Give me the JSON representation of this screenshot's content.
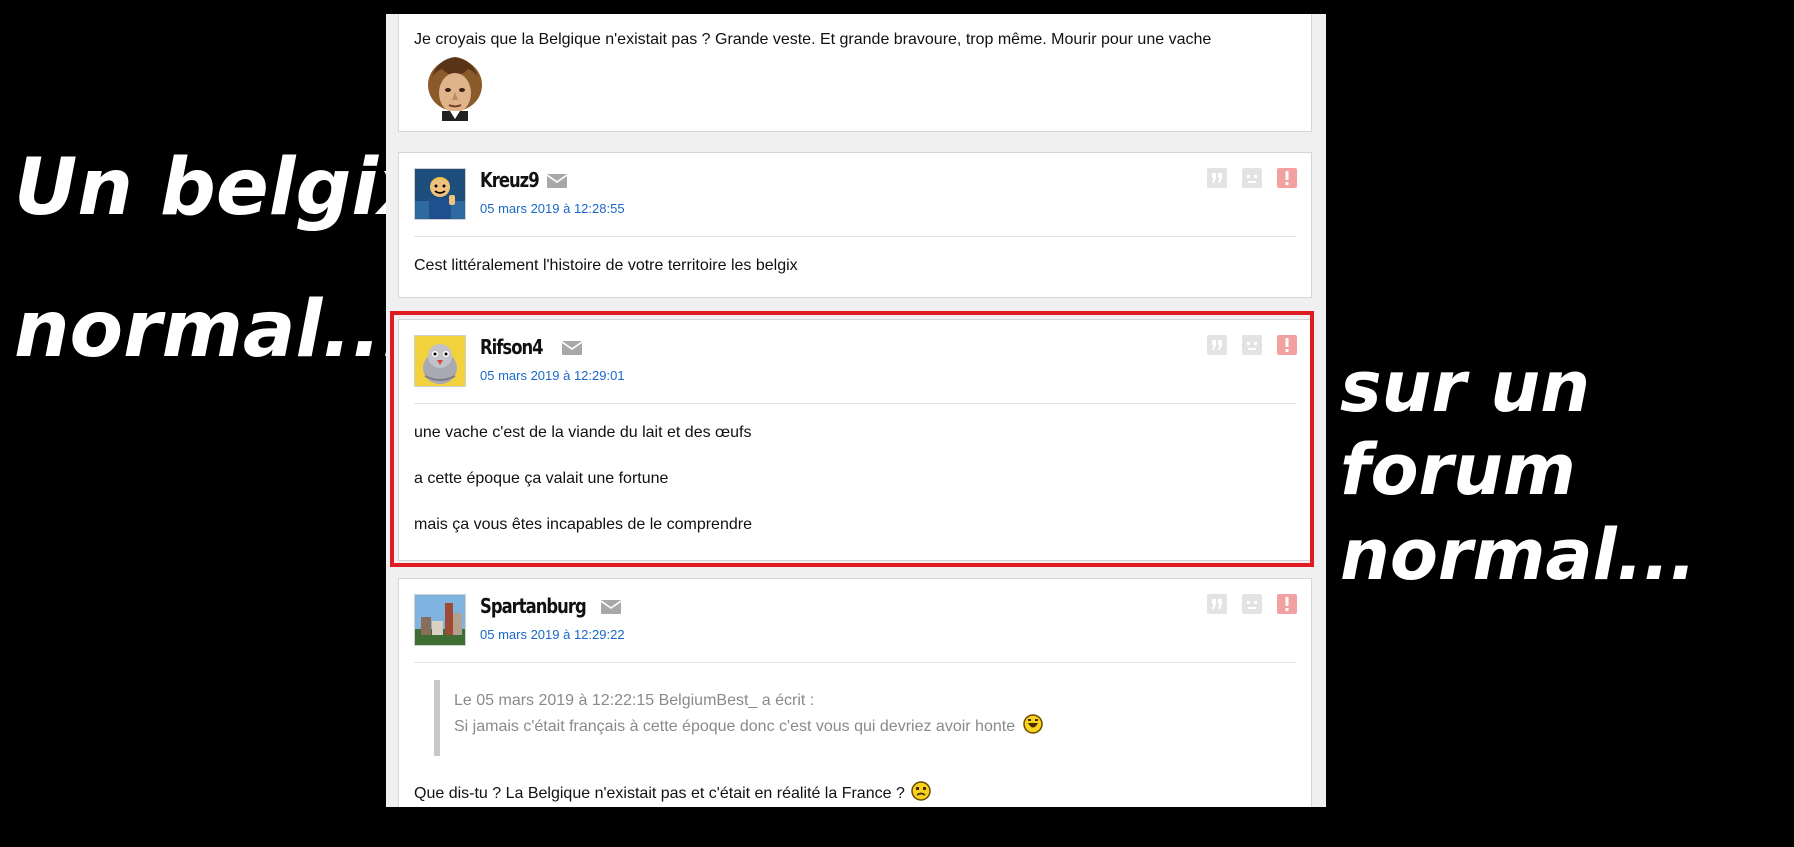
{
  "captions": {
    "left_line1": "Un belgix",
    "left_line2": "normal...",
    "right_line1": "sur un",
    "right_line2": "forum",
    "right_line3": "normal..."
  },
  "icons": [
    "mail-icon",
    "quote-icon",
    "sad-icon",
    "report-icon"
  ],
  "colors": {
    "date_link": "#1a68c8",
    "highlight": "#e01b22",
    "report": "#f2a0a0"
  },
  "posts": [
    {
      "text": "Je croyais que la Belgique n'existait pas ? Grande veste. Et grande bravoure, trop même. Mourir pour une vache"
    },
    {
      "author": "Kreuz9",
      "date": "05 mars 2019 à 12:28:55",
      "text": "Cest littéralement l'histoire de votre territoire les belgix"
    },
    {
      "author": "Rifson4",
      "date": "05 mars 2019 à 12:29:01",
      "lines": [
        "une vache c'est de la viande du lait et des œufs",
        "a cette époque ça valait une fortune",
        "mais ça vous êtes incapables de le comprendre"
      ]
    },
    {
      "author": "Spartanburg",
      "date": "05 mars 2019 à 12:29:22",
      "quote_header": "Le 05 mars 2019 à 12:22:15 BelgiumBest_ a écrit :",
      "quote_text": "Si jamais c'était français à cette époque donc c'est vous qui devriez avoir honte",
      "text": "Que dis-tu ? La Belgique n'existait pas et c'était en réalité la France ?"
    }
  ]
}
